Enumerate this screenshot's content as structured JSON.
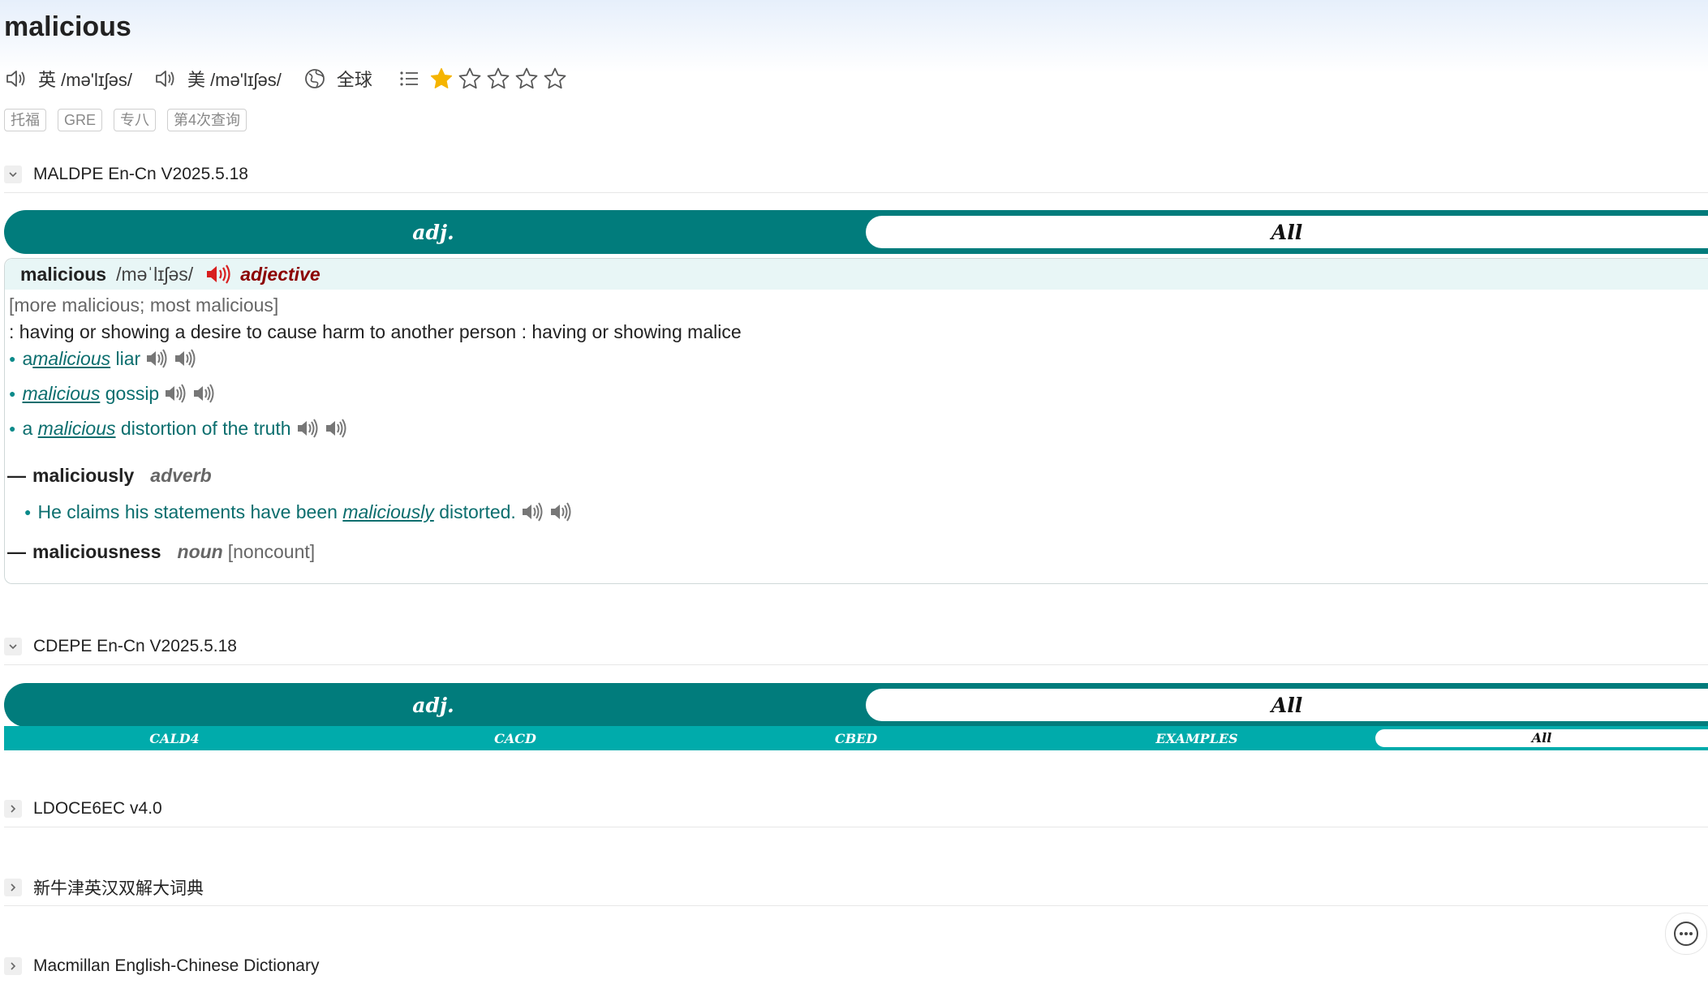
{
  "headword": "malicious",
  "pronunciations": {
    "uk_label": "英 /mə'lɪʃəs/",
    "us_label": "美 /mə'lɪʃəs/",
    "region": "全球"
  },
  "rating": {
    "filled": 1,
    "total": 5,
    "color": "#f5b400"
  },
  "tags": [
    "托福",
    "GRE",
    "专八",
    "第4次查询"
  ],
  "dictionaries": [
    {
      "name": "MALDPE En-Cn V2025.5.18",
      "expanded": true
    },
    {
      "name": "CDEPE En-Cn V2025.5.18",
      "expanded": true
    },
    {
      "name": "LDOCE6EC v4.0",
      "expanded": false
    },
    {
      "name": "新牛津英汉双解大词典",
      "expanded": false
    },
    {
      "name": "Macmillan English-Chinese Dictionary",
      "expanded": false
    }
  ],
  "maldpe": {
    "tabs": {
      "pos": "adj.",
      "all": "All"
    },
    "entry": {
      "headword": "malicious",
      "pron": "/məˈlɪʃəs/",
      "pos": "adjective",
      "forms": "[more malicious; most malicious]",
      "definition": ": having or showing a desire to cause harm to another person : having or showing malice",
      "examples": [
        {
          "pre": "a ",
          "kw": "malicious",
          "post": " liar"
        },
        {
          "pre": "",
          "kw": "malicious",
          "post": " gossip"
        },
        {
          "pre": "a ",
          "kw": "malicious",
          "post": " distortion of the truth"
        }
      ],
      "derived1": {
        "dash": "—",
        "word": "maliciously",
        "pos": "adverb"
      },
      "derived1_example": {
        "pre": "He claims his statements have been ",
        "kw": "maliciously",
        "post": " distorted."
      },
      "derived2": {
        "dash": "—",
        "word": "maliciousness",
        "pos": "noun",
        "extra": "[noncount]"
      }
    }
  },
  "cdepe": {
    "tabs": {
      "pos": "adj.",
      "all": "All"
    },
    "subtabs": [
      "CALD4",
      "CACD",
      "CBED",
      "EXAMPLES",
      "All"
    ]
  },
  "colors": {
    "teal_dark": "#017c7c",
    "teal_light": "#00abab",
    "pos_red": "#8b0000"
  }
}
